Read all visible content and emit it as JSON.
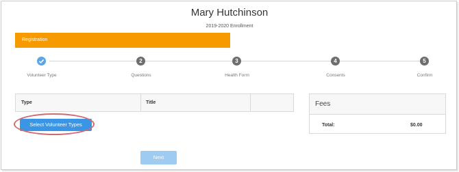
{
  "header": {
    "name": "Mary Hutchinson",
    "subtitle": "2019-2020 Enrollment"
  },
  "registration_bar": {
    "label": "Registration",
    "color": "#f79a00"
  },
  "steps": [
    {
      "number": "1",
      "label": "Volunteer Type",
      "status": "complete",
      "icon": "checkmark-icon"
    },
    {
      "number": "2",
      "label": "Questions",
      "status": "pending"
    },
    {
      "number": "3",
      "label": "Health Form",
      "status": "pending"
    },
    {
      "number": "4",
      "label": "Consents",
      "status": "pending"
    },
    {
      "number": "5",
      "label": "Confirm",
      "status": "pending"
    }
  ],
  "table": {
    "columns": [
      "Type",
      "Title",
      ""
    ]
  },
  "select_button": {
    "label": "Select Volunteer Types",
    "color": "#3a95e4",
    "highlight_color": "#d06a70"
  },
  "next_button": {
    "label": "Next"
  },
  "fees": {
    "title": "Fees",
    "total_label": "Total:",
    "total_value": "$0.00"
  }
}
